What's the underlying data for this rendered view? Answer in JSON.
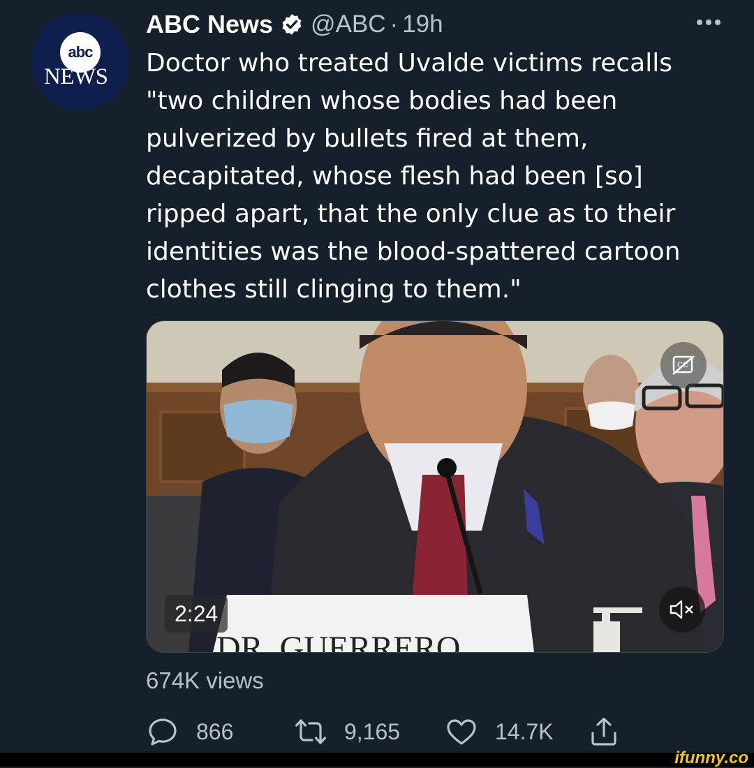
{
  "tweet": {
    "author_name": "ABC News",
    "handle": "@ABC",
    "separator": "·",
    "time": "19h",
    "avatar_text_top": "abc",
    "avatar_text_bottom": "NEWS",
    "text": "Doctor who treated Uvalde victims recalls\n\"two children whose bodies had been\npulverized by bullets fired at them,\ndecapitated, whose flesh had been [so]\nripped apart, that the only clue as to their\nidentities was the blood-spattered cartoon\nclothes still clinging to them.\""
  },
  "video": {
    "duration": "2:24",
    "placard_text": "DR. GUERRERO"
  },
  "views": "674K views",
  "actions": {
    "replies": "866",
    "retweets": "9,165",
    "likes": "14.7K"
  },
  "watermark": "ifunny.co",
  "colors": {
    "background": "#15202b",
    "secondary_text": "#b8c2cc",
    "verified_badge": "#ffffff",
    "watermark": "#f2c418"
  },
  "icons": [
    "more-icon",
    "verified-icon",
    "closed-captions-icon",
    "mute-icon",
    "reply-icon",
    "retweet-icon",
    "like-icon",
    "share-icon"
  ]
}
